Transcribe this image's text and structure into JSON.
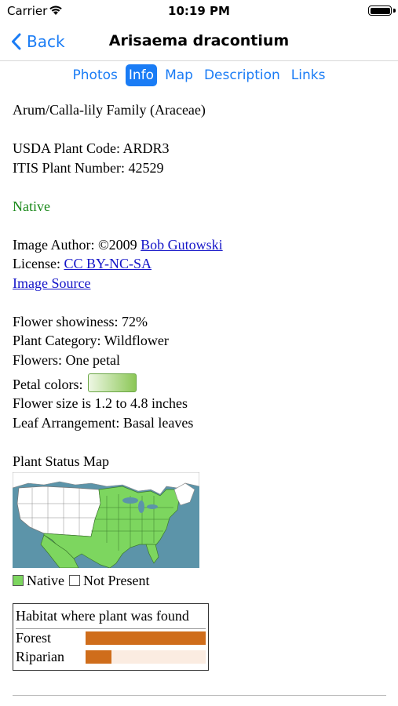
{
  "status": {
    "carrier": "Carrier",
    "time": "10:19 PM"
  },
  "nav": {
    "back_label": "Back",
    "title": "Arisaema dracontium"
  },
  "tabs": [
    {
      "label": "Photos",
      "active": false
    },
    {
      "label": "Info",
      "active": true
    },
    {
      "label": "Map",
      "active": false
    },
    {
      "label": "Description",
      "active": false
    },
    {
      "label": "Links",
      "active": false
    }
  ],
  "info": {
    "family": "Arum/Calla-lily Family (Araceae)",
    "usda_code": "USDA Plant Code: ARDR3",
    "itis_number": "ITIS Plant Number: 42529",
    "native_status": "Native",
    "image_author_prefix": "Image Author: ©2009 ",
    "image_author_name": "Bob Gutowski",
    "license_prefix": "License: ",
    "license_name": "CC BY-NC-SA",
    "image_source": "Image Source",
    "flower_showiness": "Flower showiness: 72%",
    "plant_category": "Plant Category: Wildflower",
    "flowers": "Flowers: One petal",
    "petal_colors_label": "Petal colors:",
    "flower_size": "Flower size is 1.2 to 4.8 inches",
    "leaf_arrangement": "Leaf Arrangement: Basal leaves"
  },
  "map": {
    "title": "Plant Status Map",
    "legend_native": "Native",
    "legend_not_present": "Not Present"
  },
  "habitat": {
    "title": "Habitat where plant was found",
    "rows": [
      {
        "label": "Forest",
        "fraction": 1.0
      },
      {
        "label": "Riparian",
        "fraction": 0.22
      }
    ]
  },
  "colors": {
    "accent": "#1a7cf5",
    "native_green": "#1b8a1b",
    "map_native": "#7dd65f",
    "map_water": "#5c94a9",
    "habitat_bar": "#cf6d1b",
    "habitat_track": "#fbece1"
  },
  "icons": [
    "wifi-icon",
    "battery-icon",
    "back-chevron-icon"
  ]
}
